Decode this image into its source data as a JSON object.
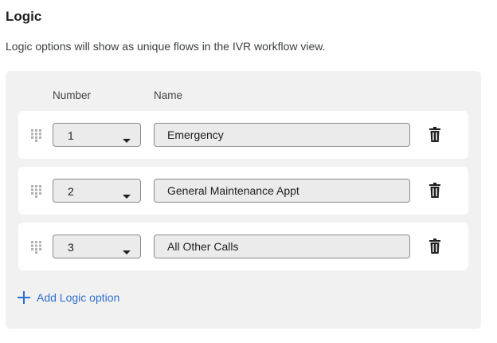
{
  "section": {
    "title": "Logic",
    "description": "Logic options will show as unique flows in the IVR workflow view."
  },
  "table": {
    "columns": {
      "number": "Number",
      "name": "Name"
    },
    "rows": [
      {
        "number": "1",
        "name": "Emergency"
      },
      {
        "number": "2",
        "name": "General Maintenance Appt"
      },
      {
        "number": "3",
        "name": "All Other Calls"
      }
    ]
  },
  "add_button": {
    "label": "Add Logic option"
  },
  "icons": {
    "drag": "drag-handle-icon",
    "dropdown": "caret-down-icon",
    "delete": "trash-icon",
    "add": "plus-icon"
  },
  "colors": {
    "accent": "#2f6fcf",
    "panel_bg": "#f1f1f1",
    "field_bg": "#ebebeb"
  }
}
